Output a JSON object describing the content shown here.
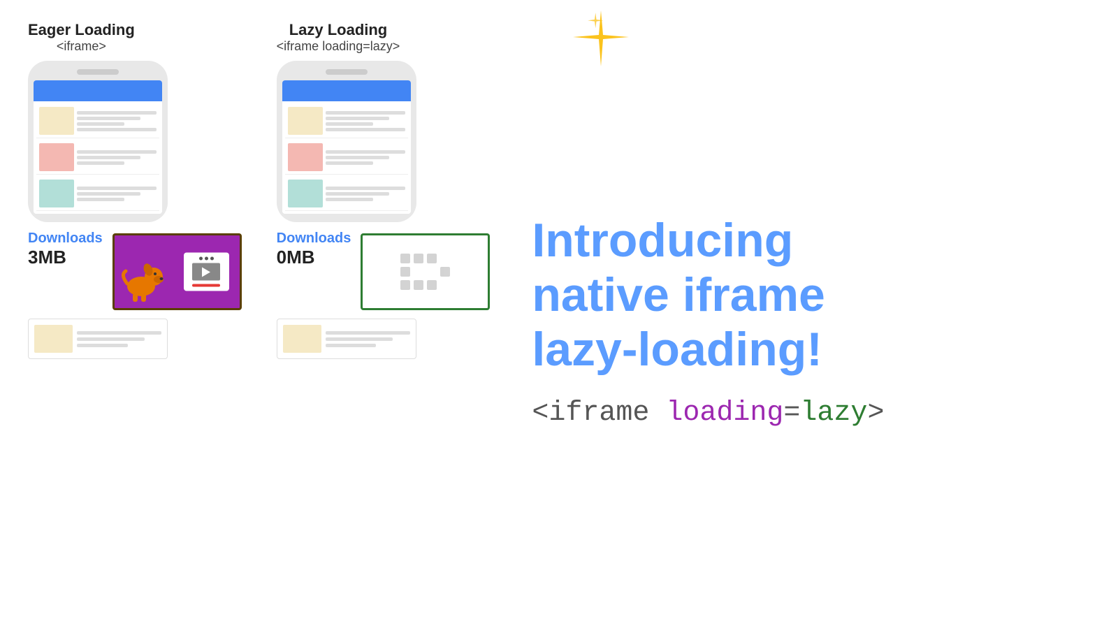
{
  "eager": {
    "title": "Eager Loading",
    "subtitle": "<iframe>",
    "downloads_label": "Downloads",
    "downloads_amount": "3MB"
  },
  "lazy": {
    "title": "Lazy Loading",
    "subtitle": "<iframe loading=lazy>",
    "downloads_label": "Downloads",
    "downloads_amount": "0MB"
  },
  "intro": {
    "heading_line1": "Introducing",
    "heading_line2": "native iframe",
    "heading_line3": "lazy-loading!"
  },
  "code": {
    "prefix": "<iframe ",
    "loading": "loading",
    "equals": "=",
    "lazy": "lazy",
    "suffix": ">"
  },
  "cards": {
    "colors": {
      "card1_img": "#f5e9c5",
      "card2_img": "#f4b8b2",
      "card3_img": "#b2dfd8"
    }
  }
}
